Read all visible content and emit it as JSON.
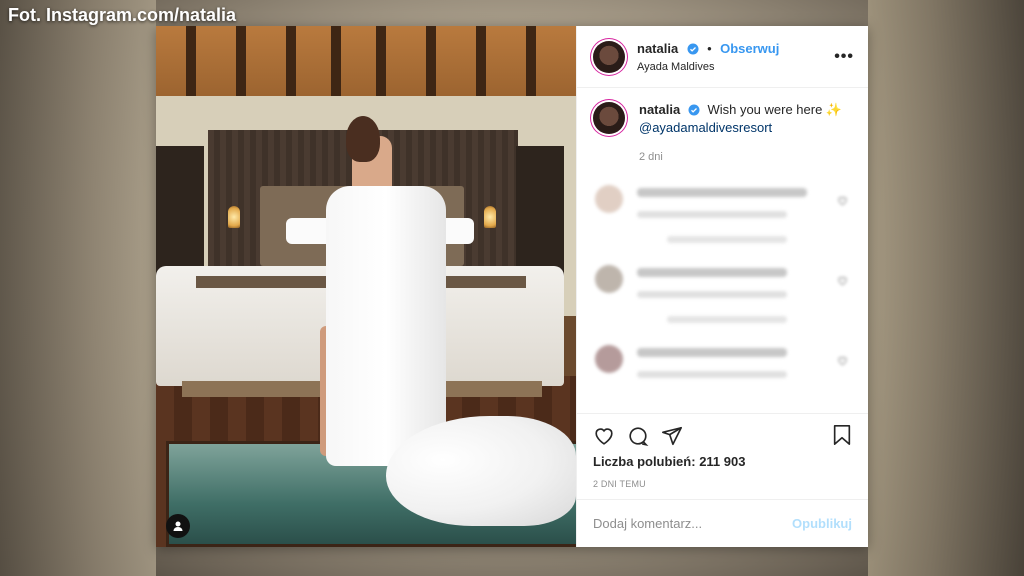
{
  "overlay": {
    "credit": "Fot. Instagram.com/natalia"
  },
  "post": {
    "header": {
      "username": "natalia",
      "separator": "•",
      "follow_label": "Obserwuj",
      "location": "Ayada Maldives",
      "more_icon": "more-horizontal-icon"
    },
    "caption": {
      "username": "natalia",
      "text": "Wish you were here ✨",
      "mention": "@ayadamaldivesresort",
      "time": "2 dni"
    },
    "actions": {
      "like_icon": "heart-icon",
      "comment_icon": "comment-icon",
      "share_icon": "send-icon",
      "save_icon": "bookmark-icon"
    },
    "likes": {
      "label": "Liczba polubień:",
      "count": "211 903"
    },
    "date": "2 DNI TEMU",
    "comment_box": {
      "placeholder": "Dodaj komentarz...",
      "submit_label": "Opublikuj"
    },
    "colors": {
      "link": "#3897f0",
      "verified": "#3897f0",
      "text": "#262626",
      "muted": "#8e8e8e",
      "post_disabled": "#b2dffc"
    }
  }
}
